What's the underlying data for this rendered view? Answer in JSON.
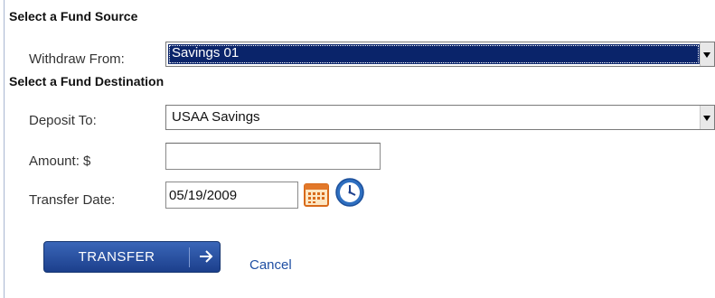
{
  "source_section": {
    "title": "Select a Fund Source",
    "withdraw_label": "Withdraw From:",
    "withdraw_value": "Savings 01"
  },
  "destination_section": {
    "title": "Select a Fund Destination",
    "deposit_label": "Deposit To:",
    "deposit_value": "USAA Savings",
    "amount_label": "Amount: $",
    "amount_value": "",
    "date_label": "Transfer Date:",
    "date_value": "05/19/2009"
  },
  "actions": {
    "transfer_label": "TRANSFER",
    "cancel_label": "Cancel"
  },
  "icons": {
    "calendar": "calendar-icon",
    "clock": "clock-icon",
    "arrow": "arrow-right-icon",
    "dropdown": "chevron-down-icon"
  },
  "colors": {
    "selected_bg": "#0a246a",
    "button": "#1f4a9c",
    "link": "#1f4fa3"
  }
}
